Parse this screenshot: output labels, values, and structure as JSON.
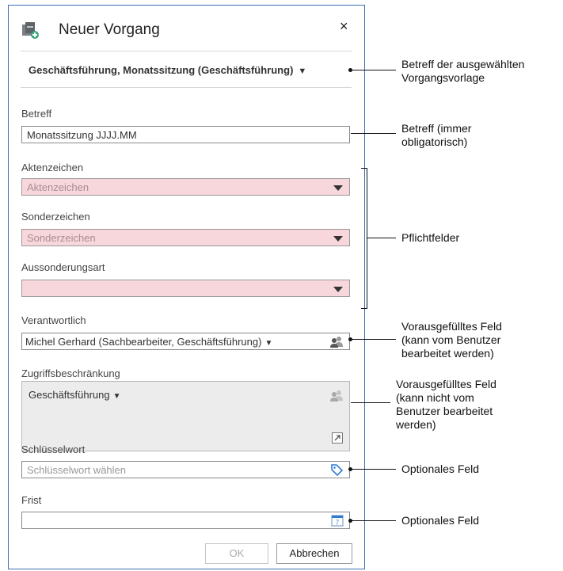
{
  "dialog": {
    "title": "Neuer Vorgang",
    "close_label": "×",
    "template": "Geschäftsführung, Monatssitzung (Geschäftsführung)"
  },
  "fields": {
    "betreff": {
      "label": "Betreff",
      "value": "Monatssitzung JJJJ.MM"
    },
    "aktenzeichen": {
      "label": "Aktenzeichen",
      "placeholder": "Aktenzeichen"
    },
    "sonderzeichen": {
      "label": "Sonderzeichen",
      "placeholder": "Sonderzeichen"
    },
    "aussonderungsart": {
      "label": "Aussonderungsart",
      "value": ""
    },
    "verantwortlich": {
      "label": "Verantwortlich",
      "value": "Michel Gerhard (Sachbearbeiter, Geschäftsführung)"
    },
    "zugriff": {
      "label": "Zugriffsbeschränkung",
      "value": "Geschäftsführung"
    },
    "schluesselwort": {
      "label": "Schlüsselwort",
      "placeholder": "Schlüsselwort wählen"
    },
    "frist": {
      "label": "Frist",
      "value": ""
    }
  },
  "buttons": {
    "ok": "OK",
    "cancel": "Abbrechen"
  },
  "annotations": {
    "template": [
      "Betreff der ausgewählten",
      "Vorgangsvorlage"
    ],
    "betreff": [
      "Betreff (immer",
      "obligatorisch)"
    ],
    "pflicht": [
      "Pflichtfelder"
    ],
    "prefilled_editable": [
      "Vorausgefülltes Feld",
      "(kann vom Benutzer",
      "bearbeitet werden)"
    ],
    "prefilled_locked": [
      "Vorausgefülltes Feld",
      "(kann nicht vom",
      "Benutzer bearbeitet",
      "werden)"
    ],
    "optional1": [
      "Optionales Feld"
    ],
    "optional2": [
      "Optionales Feld"
    ]
  },
  "colors": {
    "required_bg": "#f7d6dc",
    "border_accent": "#3d6fb6",
    "icon_blue": "#2e7bd6",
    "locked_bg": "#ececec"
  },
  "icons": [
    "new-process-icon",
    "close-icon",
    "dropdown-caret-icon",
    "person-group-icon",
    "expand-icon",
    "tag-icon",
    "calendar-icon"
  ]
}
